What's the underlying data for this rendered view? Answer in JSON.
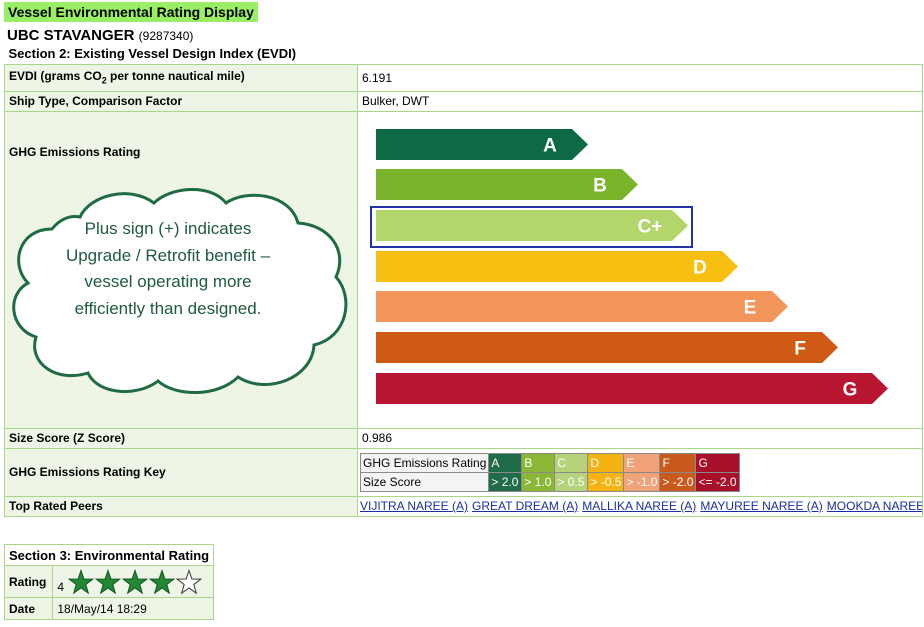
{
  "page_title": "Vessel Environmental Rating Display",
  "vessel": {
    "name": "UBC STAVANGER",
    "imo": "(9287340)"
  },
  "section2": {
    "heading": "Section 2: Existing Vessel Design Index (EVDI)",
    "evdi_label_pre": "EVDI (grams CO",
    "evdi_label_sub": "2",
    "evdi_label_post": " per tonne nautical mile)",
    "evdi_value": "6.191",
    "ship_type_label": "Ship Type, Comparison Factor",
    "ship_type_value": "Bulker, DWT",
    "ghg_label": "GHG Emissions Rating",
    "ratings": [
      {
        "label": "A",
        "color": "#0d6a45"
      },
      {
        "label": "B",
        "color": "#7ab42a"
      },
      {
        "label": "C+",
        "color": "#b2d66a"
      },
      {
        "label": "D",
        "color": "#f6bf12"
      },
      {
        "label": "E",
        "color": "#f1955a"
      },
      {
        "label": "F",
        "color": "#cf5a14"
      },
      {
        "label": "G",
        "color": "#b81530"
      }
    ],
    "selected_rating": "C+",
    "size_score_label": "Size Score (Z Score)",
    "size_score_value": "0.986",
    "key_label": "GHG Emissions Rating Key",
    "key": {
      "row1_label": "GHG Emissions Rating",
      "row2_label": "Size Score",
      "grades": [
        "A",
        "B",
        "C",
        "D",
        "E",
        "F",
        "G"
      ],
      "scores": [
        "> 2.0",
        "> 1.0",
        "> 0.5",
        "> -0.5",
        "> -1.0",
        "> -2.0",
        "<= -2.0"
      ],
      "colors": [
        "#1f6b4a",
        "#8ab836",
        "#b6d27a",
        "#f2b313",
        "#f0a27a",
        "#c85a1d",
        "#a8102a"
      ]
    },
    "peers_label": "Top Rated Peers",
    "peers": [
      "VIJITRA NAREE (A)",
      "GREAT DREAM (A)",
      "MALLIKA NAREE (A)",
      "MAYUREE NAREE (A)",
      "MOOKDA NAREE (A)"
    ]
  },
  "callout": {
    "text": "Plus sign (+) indicates Upgrade / Retrofit benefit – vessel operating more efficiently than designed."
  },
  "section3": {
    "heading": "Section 3: Environmental Rating",
    "rating_label": "Rating",
    "rating_value": "4",
    "stars_filled": 4,
    "stars_total": 5,
    "date_label": "Date",
    "date_value": "18/May/14 18:29"
  }
}
